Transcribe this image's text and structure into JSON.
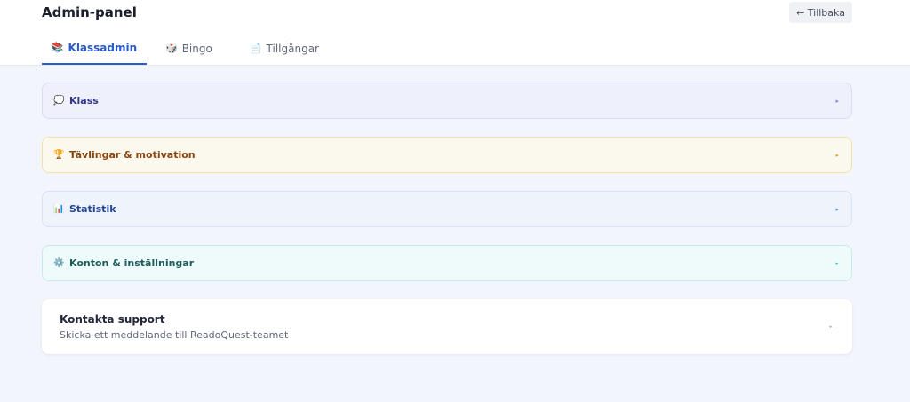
{
  "header": {
    "title": "Admin-panel",
    "back_label": "← Tillbaka"
  },
  "tabs": [
    {
      "icon": "📚",
      "label": "Klassadmin",
      "active": true
    },
    {
      "icon": "🎲",
      "label": "Bingo",
      "active": false
    },
    {
      "icon": "📄",
      "label": "Tillgångar",
      "active": false
    }
  ],
  "panels": [
    {
      "icon": "💭",
      "label": "Klass",
      "color": "#33358b"
    },
    {
      "icon": "🏆",
      "label": "Tävlingar & motivation",
      "color": "#8a4510"
    },
    {
      "icon": "📊",
      "label": "Statistik",
      "color": "#25459a"
    },
    {
      "icon": "⚙️",
      "label": "Konton & inställningar",
      "color": "#1d5c5a"
    }
  ],
  "arrow": "▸",
  "support": {
    "title": "Kontakta support",
    "subtitle": "Skicka ett meddelande till ReadoQuest-teamet"
  }
}
